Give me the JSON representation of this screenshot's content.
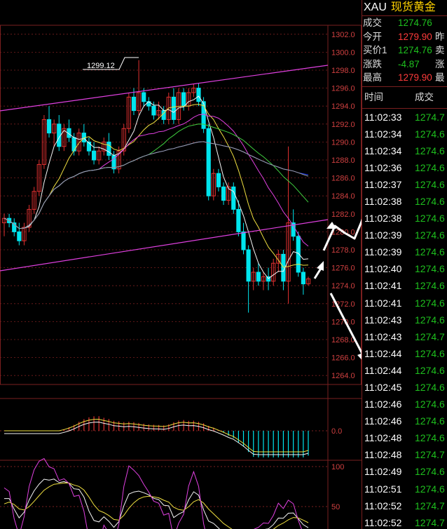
{
  "header": {
    "symbol": "XAU",
    "name": "现货黄金"
  },
  "quote": [
    {
      "label": "成交",
      "value": "1274.76",
      "value_color": "#1ec01e",
      "label2": ""
    },
    {
      "label": "今开",
      "value": "1279.90",
      "value_color": "#ff3b3b",
      "label2": "昨"
    },
    {
      "label": "买价1",
      "value": "1274.76",
      "value_color": "#1ec01e",
      "label2": "卖"
    },
    {
      "label": "涨跌",
      "value": "-4.87",
      "value_color": "#1ec01e",
      "label2": "涨"
    },
    {
      "label": "最高",
      "value": "1279.90",
      "value_color": "#ff3b3b",
      "label2": "最"
    }
  ],
  "ticks_header": {
    "time": "时间",
    "price": "成交"
  },
  "ticks": [
    {
      "time": "11:02:33",
      "price": "1274.7"
    },
    {
      "time": "11:02:34",
      "price": "1274.6"
    },
    {
      "time": "11:02:34",
      "price": "1274.6"
    },
    {
      "time": "11:02:36",
      "price": "1274.6"
    },
    {
      "time": "11:02:37",
      "price": "1274.6"
    },
    {
      "time": "11:02:38",
      "price": "1274.6"
    },
    {
      "time": "11:02:38",
      "price": "1274.6"
    },
    {
      "time": "11:02:39",
      "price": "1274.6"
    },
    {
      "time": "11:02:39",
      "price": "1274.6"
    },
    {
      "time": "11:02:40",
      "price": "1274.6"
    },
    {
      "time": "11:02:41",
      "price": "1274.6"
    },
    {
      "time": "11:02:41",
      "price": "1274.6"
    },
    {
      "time": "11:02:43",
      "price": "1274.6"
    },
    {
      "time": "11:02:43",
      "price": "1274.7"
    },
    {
      "time": "11:02:44",
      "price": "1274.6"
    },
    {
      "time": "11:02:44",
      "price": "1274.6"
    },
    {
      "time": "11:02:45",
      "price": "1274.6"
    },
    {
      "time": "11:02:46",
      "price": "1274.6"
    },
    {
      "time": "11:02:46",
      "price": "1274.6"
    },
    {
      "time": "11:02:48",
      "price": "1274.6"
    },
    {
      "time": "11:02:48",
      "price": "1274.7"
    },
    {
      "time": "11:02:49",
      "price": "1274.6"
    },
    {
      "time": "11:02:51",
      "price": "1274.6"
    },
    {
      "time": "11:02:52",
      "price": "1274.7"
    },
    {
      "time": "11:02:52",
      "price": "1274.7"
    }
  ],
  "chart_data": {
    "type": "candlestick",
    "y_axis_ticks": [
      "1302.0",
      "1300.0",
      "1298.0",
      "1296.0",
      "1294.0",
      "1292.0",
      "1290.0",
      "1288.0",
      "1286.0",
      "1284.0",
      "1282.0",
      "1280.0",
      "1278.0",
      "1276.0",
      "1274.0",
      "1272.0",
      "1270.0",
      "1268.0",
      "1266.0",
      "1264.0"
    ],
    "ylim": [
      1263,
      1303
    ],
    "annotation": "1299.12",
    "candles": [
      [
        1281,
        1282,
        1279.5,
        1281.5
      ],
      [
        1281.5,
        1282,
        1280.5,
        1281
      ],
      [
        1281,
        1281.5,
        1279.5,
        1280
      ],
      [
        1280,
        1281,
        1278.5,
        1279
      ],
      [
        1279,
        1281,
        1278.5,
        1280.5
      ],
      [
        1280.5,
        1283,
        1280,
        1282.5
      ],
      [
        1282.5,
        1285,
        1282,
        1284.5
      ],
      [
        1284.5,
        1288,
        1284,
        1287.5
      ],
      [
        1287.5,
        1293,
        1287,
        1292.5
      ],
      [
        1292.5,
        1294,
        1290.5,
        1291
      ],
      [
        1291,
        1292.5,
        1289.5,
        1292
      ],
      [
        1292,
        1293,
        1289,
        1289.5
      ],
      [
        1289.5,
        1292,
        1289,
        1291.5
      ],
      [
        1291.5,
        1292.5,
        1290,
        1290.5
      ],
      [
        1290.5,
        1291,
        1288.5,
        1289
      ],
      [
        1289,
        1291.5,
        1288.5,
        1291
      ],
      [
        1291,
        1292,
        1289.5,
        1290
      ],
      [
        1290,
        1290.5,
        1288.5,
        1289
      ],
      [
        1289,
        1290,
        1287.5,
        1288
      ],
      [
        1288,
        1289.5,
        1287.5,
        1289
      ],
      [
        1289,
        1290.5,
        1288.5,
        1290
      ],
      [
        1290,
        1291,
        1288,
        1288.5
      ],
      [
        1288.5,
        1289,
        1286.5,
        1287
      ],
      [
        1287,
        1289.5,
        1286.5,
        1289
      ],
      [
        1289,
        1292,
        1288.5,
        1291.5
      ],
      [
        1291.5,
        1295.5,
        1291,
        1295
      ],
      [
        1295,
        1296,
        1293,
        1293.5
      ],
      [
        1293.5,
        1299.12,
        1293,
        1295.5
      ],
      [
        1295.5,
        1296,
        1294,
        1294.5
      ],
      [
        1294.5,
        1295,
        1293.5,
        1294
      ],
      [
        1294,
        1294.5,
        1292.5,
        1293
      ],
      [
        1293,
        1294.5,
        1292.5,
        1293.5
      ],
      [
        1293.5,
        1294,
        1292,
        1292.5
      ],
      [
        1292.5,
        1295.5,
        1292,
        1295
      ],
      [
        1295,
        1296,
        1292,
        1292.5
      ],
      [
        1292.5,
        1296,
        1292,
        1295.5
      ],
      [
        1295.5,
        1296,
        1293.5,
        1294
      ],
      [
        1294,
        1296,
        1293.5,
        1295.5
      ],
      [
        1295.5,
        1296.5,
        1295,
        1296
      ],
      [
        1296,
        1296.5,
        1294,
        1294.5
      ],
      [
        1294.5,
        1295,
        1291,
        1291.5
      ],
      [
        1291.5,
        1292,
        1283.5,
        1284
      ],
      [
        1284,
        1287,
        1283.5,
        1286.5
      ],
      [
        1286.5,
        1287,
        1284.5,
        1285
      ],
      [
        1285,
        1285.5,
        1283,
        1283.5
      ],
      [
        1283.5,
        1285.5,
        1283,
        1285
      ],
      [
        1285,
        1285.5,
        1282,
        1282.5
      ],
      [
        1282.5,
        1283.5,
        1279.5,
        1280
      ],
      [
        1280,
        1281,
        1277.5,
        1278
      ],
      [
        1278,
        1278.5,
        1271,
        1274.5
      ],
      [
        1274.5,
        1276,
        1273.5,
        1275.5
      ],
      [
        1275.5,
        1276.5,
        1274,
        1274.5
      ],
      [
        1274.5,
        1275.5,
        1273.5,
        1275
      ],
      [
        1275,
        1276,
        1273.5,
        1274.5
      ],
      [
        1274.5,
        1277,
        1274,
        1276.5
      ],
      [
        1276.5,
        1278,
        1275.5,
        1277.5
      ],
      [
        1277.5,
        1278,
        1273.5,
        1274.5
      ],
      [
        1274.5,
        1289.5,
        1272,
        1281
      ],
      [
        1281,
        1282.5,
        1279,
        1279.5
      ],
      [
        1279.5,
        1280,
        1275,
        1275.5
      ],
      [
        1275.5,
        1276,
        1273,
        1274.2
      ],
      [
        1274.2,
        1275,
        1274,
        1274.76
      ]
    ]
  },
  "colors": {
    "up": "#e03030",
    "down": "#00e5ee",
    "grid": "#7a1f1f",
    "axis_label": "#d04040"
  }
}
